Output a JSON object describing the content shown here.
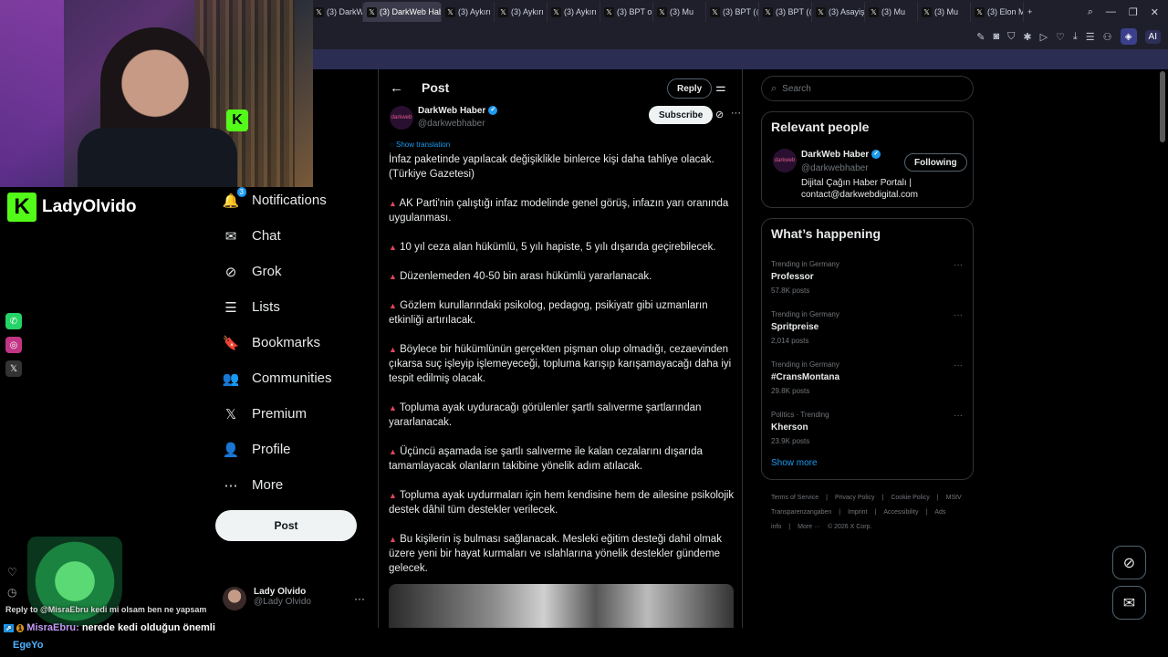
{
  "browser": {
    "tabs": [
      {
        "label": "(3) DarkW",
        "active": false
      },
      {
        "label": "(3) DarkWeb Haber",
        "active": true
      },
      {
        "label": "(3) Aykırı",
        "active": false
      },
      {
        "label": "(3) Aykırı",
        "active": false
      },
      {
        "label": "(3) Aykırı",
        "active": false
      },
      {
        "label": "(3) BPT on",
        "active": false
      },
      {
        "label": "(3) Mu",
        "active": false
      },
      {
        "label": "(3) BPT (@",
        "active": false
      },
      {
        "label": "(3) BPT (@",
        "active": false
      },
      {
        "label": "(3) Asayiş",
        "active": false
      },
      {
        "label": "(3) Mu",
        "active": false
      },
      {
        "label": "(3) Mu",
        "active": false
      },
      {
        "label": "(3) Elon M",
        "active": false
      }
    ],
    "new_tab": "+",
    "toolbar_ai": "AI"
  },
  "stream": {
    "channel_name": "LadyOlvido",
    "kick_letter": "K",
    "chat": [
      {
        "user": "Reply to",
        "text": "@MisraEbru kedi mi olsam ben ne yapsam"
      },
      {
        "user": "MisraEbru:",
        "text": "nerede kedi olduğun önemli"
      },
      {
        "user": "EgeYo",
        "text": ""
      }
    ],
    "counter": "1"
  },
  "nav": {
    "items": [
      {
        "label": "Notifications",
        "icon": "bell-icon",
        "glyph": "🔔",
        "badge": "3"
      },
      {
        "label": "Chat",
        "icon": "chat-icon",
        "glyph": "✉",
        "badge": ""
      },
      {
        "label": "Grok",
        "icon": "grok-icon",
        "glyph": "⊘",
        "badge": ""
      },
      {
        "label": "Lists",
        "icon": "lists-icon",
        "glyph": "☰",
        "badge": ""
      },
      {
        "label": "Bookmarks",
        "icon": "bookmark-icon",
        "glyph": "🔖",
        "badge": ""
      },
      {
        "label": "Communities",
        "icon": "communities-icon",
        "glyph": "👥",
        "badge": ""
      },
      {
        "label": "Premium",
        "icon": "x-logo-icon",
        "glyph": "𝕏",
        "badge": ""
      },
      {
        "label": "Profile",
        "icon": "profile-icon",
        "glyph": "👤",
        "badge": ""
      },
      {
        "label": "More",
        "icon": "more-icon",
        "glyph": "⋯",
        "badge": ""
      }
    ],
    "post_button": "Post",
    "account": {
      "name": "Lady Olvido",
      "handle": "@Lady Olvido"
    }
  },
  "post": {
    "header_title": "Post",
    "reply_label": "Reply",
    "author_name": "DarkWeb Haber",
    "author_handle": "@darkwebhaber",
    "avatar_text": "darkweb",
    "subscribe_label": "Subscribe",
    "show_translation": "Show translation",
    "paragraphs": [
      {
        "bullet": false,
        "text": "İnfaz paketinde yapılacak değişiklikle binlerce kişi daha tahliye olacak. (Türkiye Gazetesi)"
      },
      {
        "bullet": true,
        "text": "AK Parti'nin çalıştığı infaz modelinde genel görüş, infazın yarı oranında uygulanması."
      },
      {
        "bullet": true,
        "text": "10 yıl ceza alan hükümlü, 5 yılı hapiste, 5 yılı dışarıda geçirebilecek."
      },
      {
        "bullet": true,
        "text": "Düzenlemeden 40-50 bin arası hükümlü yararlanacak."
      },
      {
        "bullet": true,
        "text": "Gözlem kurullarındaki psikolog, pedagog, psikiyatr gibi uzmanların etkinliği artırılacak."
      },
      {
        "bullet": true,
        "text": "Böylece bir hükümlünün gerçekten pişman olup olmadığı, cezaevinden çıkarsa suç işleyip işlemeyeceği, topluma karışıp karışamayacağı daha iyi tespit edilmiş olacak."
      },
      {
        "bullet": true,
        "text": "Topluma ayak uyduracağı görülenler şartlı salıverme şartlarından yararlanacak."
      },
      {
        "bullet": true,
        "text": "Üçüncü aşamada ise şartlı salıverme ile kalan cezalarını dışarıda tamamlayacak olanların takibine yönelik adım atılacak."
      },
      {
        "bullet": true,
        "text": "Topluma ayak uydurmaları için hem kendisine hem de ailesine psikolojik destek dâhil tüm destekler verilecek."
      },
      {
        "bullet": true,
        "text": "Bu kişilerin iş bulması sağlanacak. Mesleki eğitim desteği dahil olmak üzere yeni bir hayat kurmaları ve ıslahlarına yönelik destekler gündeme gelecek."
      }
    ],
    "bullet_glyph": "▲"
  },
  "right": {
    "search_placeholder": "Search",
    "relevant_title": "Relevant people",
    "relevant_person": {
      "name": "DarkWeb Haber",
      "handle": "@darkwebhaber",
      "bio": "Dijital Çağın Haber Portalı | contact@darkwebdigital.com",
      "follow_label": "Following"
    },
    "happening_title": "What’s happening",
    "trends": [
      {
        "context": "Trending in Germany",
        "name": "Professor",
        "count": "57.8K posts"
      },
      {
        "context": "Trending in Germany",
        "name": "Spritpreise",
        "count": "2,014 posts"
      },
      {
        "context": "Trending in Germany",
        "name": "#CransMontana",
        "count": "29.8K posts"
      },
      {
        "context": "Politics · Trending",
        "name": "Kherson",
        "count": "23.9K posts"
      }
    ],
    "show_more": "Show more",
    "footer": [
      "Terms of Service",
      "|",
      "Privacy Policy",
      "|",
      "Cookie Policy",
      "|",
      "MStV Transparenzangaben",
      "|",
      "Imprint",
      "|",
      "Accessibility",
      "|",
      "Ads info",
      "|",
      "More ···",
      "© 2026 X Corp."
    ]
  },
  "colors": {
    "accent": "#1d9bf0",
    "kick_green": "#53fc18",
    "bullet_red": "#e0455a"
  }
}
